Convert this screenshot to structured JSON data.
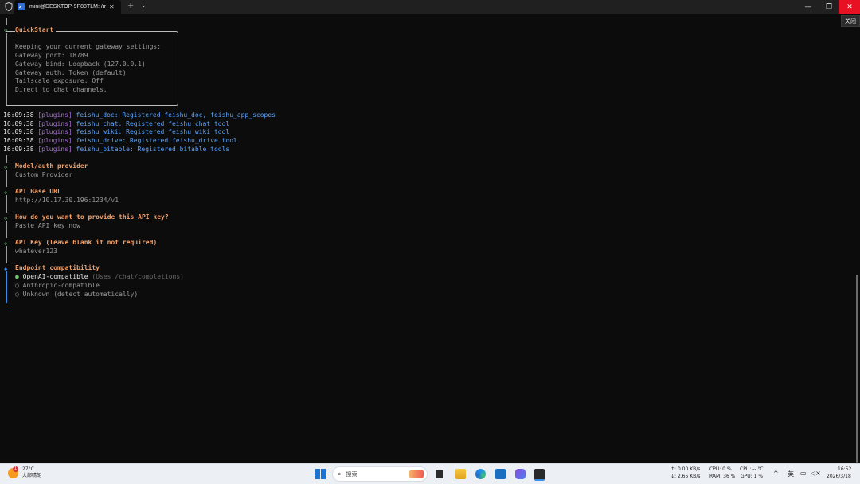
{
  "window": {
    "tab_title": "mini@DESKTOP-9P88TLM: /m",
    "tab_close": "✕",
    "new_tab": "+",
    "dropdown": "⌄",
    "minimize": "—",
    "maximize": "❐",
    "close": "✕",
    "close_tooltip": "关闭"
  },
  "quickstart": {
    "title": "QuickStart",
    "lines": [
      "Keeping your current gateway settings:",
      "Gateway port: 18789",
      "Gateway bind: Loopback (127.0.0.1)",
      "Gateway auth: Token (default)",
      "Tailscale exposure: Off",
      "Direct to chat channels."
    ]
  },
  "logs": [
    {
      "time": "16:09:38",
      "tag": "[plugins]",
      "msg": "feishu_doc: Registered feishu_doc, feishu_app_scopes"
    },
    {
      "time": "16:09:38",
      "tag": "[plugins]",
      "msg": "feishu_chat: Registered feishu_chat tool"
    },
    {
      "time": "16:09:38",
      "tag": "[plugins]",
      "msg": "feishu_wiki: Registered feishu_wiki tool"
    },
    {
      "time": "16:09:38",
      "tag": "[plugins]",
      "msg": "feishu_drive: Registered feishu_drive tool"
    },
    {
      "time": "16:09:38",
      "tag": "[plugins]",
      "msg": "feishu_bitable: Registered bitable tools"
    }
  ],
  "prompts": [
    {
      "question": "Model/auth provider",
      "answer": "Custom Provider"
    },
    {
      "question": "API Base URL",
      "answer": "http://10.17.30.196:1234/v1"
    },
    {
      "question": "How do you want to provide this API key?",
      "answer": "Paste API key now"
    },
    {
      "question": "API Key (leave blank if not required)",
      "answer": "whatever123"
    }
  ],
  "endpoint": {
    "question": "Endpoint compatibility",
    "options": [
      {
        "label": "OpenAI-compatible",
        "hint": "(Uses /chat/completions)",
        "selected": true
      },
      {
        "label": "Anthropic-compatible",
        "hint": "",
        "selected": false
      },
      {
        "label": "Unknown (detect automatically)",
        "hint": "",
        "selected": false
      }
    ]
  },
  "taskbar": {
    "weather_temp": "27°C",
    "weather_desc": "大部晴朗",
    "weather_badge": "1",
    "search_label": "搜索",
    "net_up": "↑: 0.00 KB/s",
    "net_down": "↓: 2.65 KB/s",
    "cpu": "CPU: 0 %",
    "cpu_temp": "CPU: -- °C",
    "ram": "RAM: 36 %",
    "gpu": "GPU: 1 %",
    "ime": "英",
    "time": "16:52",
    "date": "2026/3/18"
  },
  "colors": {
    "accent_orange": "#f0a16c",
    "plugin_tag": "#a36ad6",
    "log_text": "#5aa4ff",
    "diamond_green": "#6ec16e",
    "active_blue": "#3a8ee6",
    "close_red": "#e81123"
  }
}
